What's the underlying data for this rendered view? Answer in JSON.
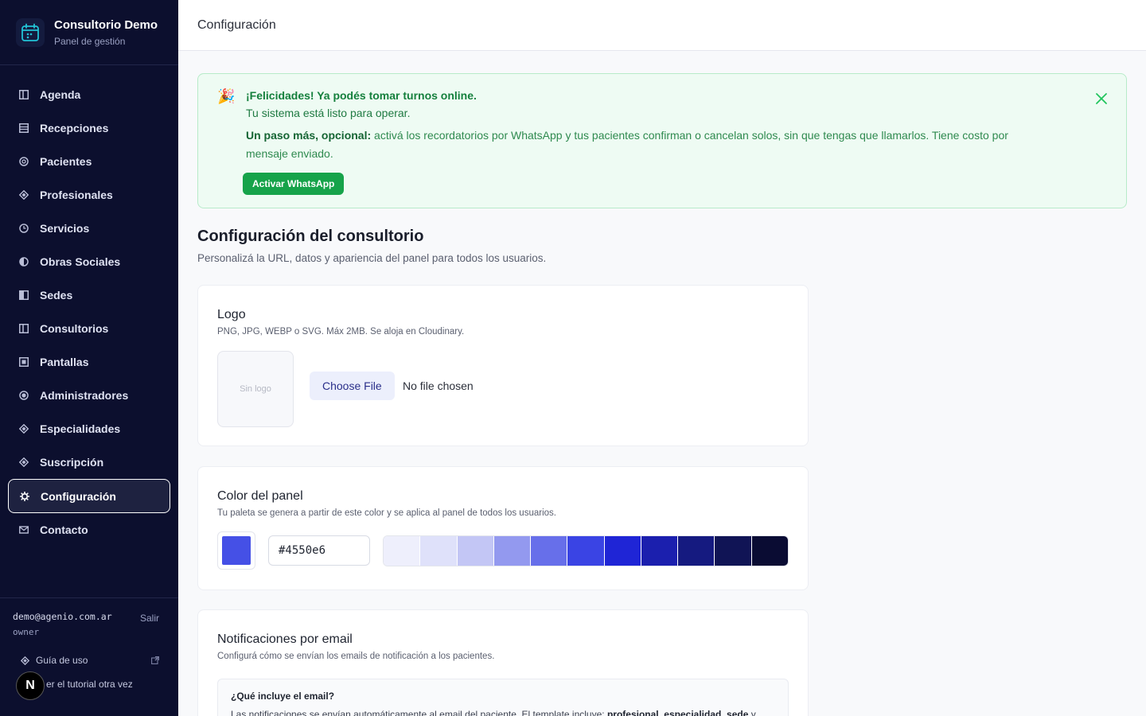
{
  "brand": {
    "title": "Consultorio Demo",
    "subtitle": "Panel de gestión"
  },
  "nav": {
    "items": [
      {
        "label": "Agenda",
        "icon": "columns-icon"
      },
      {
        "label": "Recepciones",
        "icon": "list-icon"
      },
      {
        "label": "Pacientes",
        "icon": "circle-icon"
      },
      {
        "label": "Profesionales",
        "icon": "diamond-icon"
      },
      {
        "label": "Servicios",
        "icon": "clock-icon"
      },
      {
        "label": "Obras Sociales",
        "icon": "half-circle-icon"
      },
      {
        "label": "Sedes",
        "icon": "half-square-icon"
      },
      {
        "label": "Consultorios",
        "icon": "columns-icon"
      },
      {
        "label": "Pantallas",
        "icon": "screen-icon"
      },
      {
        "label": "Administradores",
        "icon": "dot-circle-icon"
      },
      {
        "label": "Especialidades",
        "icon": "diamond-icon"
      },
      {
        "label": "Suscripción",
        "icon": "diamond-icon"
      },
      {
        "label": "Configuración",
        "icon": "gear-icon",
        "active": true
      },
      {
        "label": "Contacto",
        "icon": "mail-icon"
      }
    ]
  },
  "user": {
    "email": "demo@agenio.com.ar",
    "role": "owner",
    "logout_label": "Salir"
  },
  "footer_links": {
    "guide": "Guía de uso",
    "tutorial": "er el tutorial otra vez"
  },
  "dev_badge": "N",
  "topbar": {
    "title": "Configuración"
  },
  "banner": {
    "emoji": "🎉",
    "title": "¡Felicidades! Ya podés tomar turnos online.",
    "subtitle": "Tu sistema está listo para operar.",
    "optional_strong": "Un paso más, opcional:",
    "optional_text": " activá los recordatorios por WhatsApp y tus pacientes confirman o cancelan solos, sin que tengas que llamarlos. Tiene costo por mensaje enviado.",
    "button": "Activar WhatsApp"
  },
  "section": {
    "title": "Configuración del consultorio",
    "subtitle": "Personalizá la URL, datos y apariencia del panel para todos los usuarios."
  },
  "logo_card": {
    "title": "Logo",
    "description": "PNG, JPG, WEBP o SVG. Máx 2MB. Se aloja en Cloudinary.",
    "placeholder": "Sin logo",
    "file_button": "Choose File",
    "file_status": "No file chosen"
  },
  "color_card": {
    "title": "Color del panel",
    "description": "Tu paleta se genera a partir de este color y se aplica al panel de todos los usuarios.",
    "value": "#4550e6",
    "palette": [
      "#eeeffc",
      "#dfe1fa",
      "#c3c6f5",
      "#9399ef",
      "#676fea",
      "#3a44e4",
      "#1f25d6",
      "#1b1fae",
      "#151a80",
      "#101455",
      "#0a0c33"
    ]
  },
  "email_card": {
    "title": "Notificaciones por email",
    "description": "Configurá cómo se envían los emails de notificación a los pacientes.",
    "info_title": "¿Qué incluye el email?",
    "info_text_prefix": "Las notificaciones se envían automáticamente al email del paciente. El template incluye: ",
    "info_bold_1": "profesional",
    "info_sep_1": ", ",
    "info_bold_2": "especialidad",
    "info_sep_2": ", ",
    "info_bold_3": "sede",
    "info_suffix": " y"
  }
}
